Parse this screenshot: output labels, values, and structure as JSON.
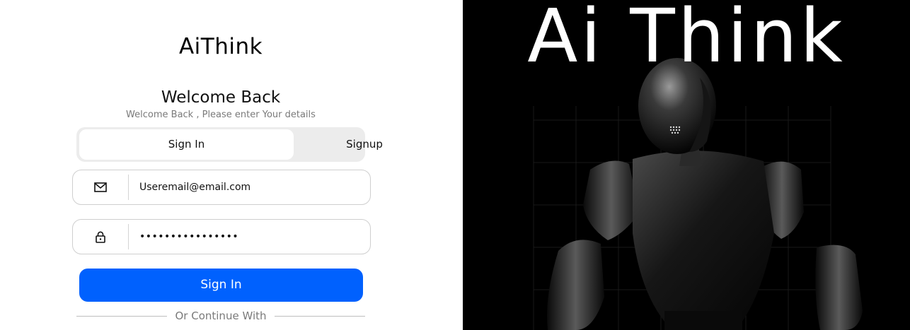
{
  "brand": {
    "name": "AiThink"
  },
  "welcome": {
    "title": "Welcome Back",
    "subtitle": "Welcome Back , Please enter Your details"
  },
  "tabs": [
    {
      "label": "Sign In",
      "active": true
    },
    {
      "label": "Signup",
      "active": false
    }
  ],
  "email_field": {
    "icon": "mail-icon",
    "placeholder": "Useremail@email.com"
  },
  "password_field": {
    "icon": "lock-icon",
    "value_masked": "••••••••••••••••"
  },
  "signin_button": {
    "label": "Sign In",
    "color": "#0061fe"
  },
  "divider": {
    "text": "Or Continue With"
  },
  "hero": {
    "title": "Ai Think",
    "image": "robot-illustration"
  }
}
